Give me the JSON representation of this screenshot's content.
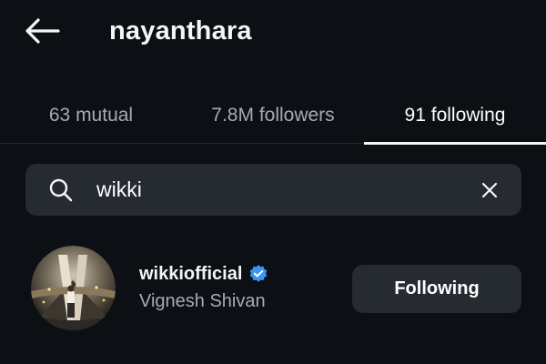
{
  "header": {
    "back_icon": "arrow-left-icon",
    "title": "nayanthara"
  },
  "tabs": [
    {
      "label": "63 mutual",
      "active": false
    },
    {
      "label": "7.8M followers",
      "active": false
    },
    {
      "label": "91 following",
      "active": true
    }
  ],
  "search": {
    "icon": "search-icon",
    "value": "wikki",
    "clear_icon": "close-icon"
  },
  "results": [
    {
      "avatar_icon": "avatar",
      "username": "wikkiofficial",
      "verified": true,
      "display_name": "Vignesh Shivan",
      "button_label": "Following"
    }
  ],
  "colors": {
    "background": "#0c0f14",
    "surface": "#262a31",
    "text_primary": "#f5f5f5",
    "text_secondary": "#a8abb0",
    "verified_blue": "#3897f0"
  }
}
